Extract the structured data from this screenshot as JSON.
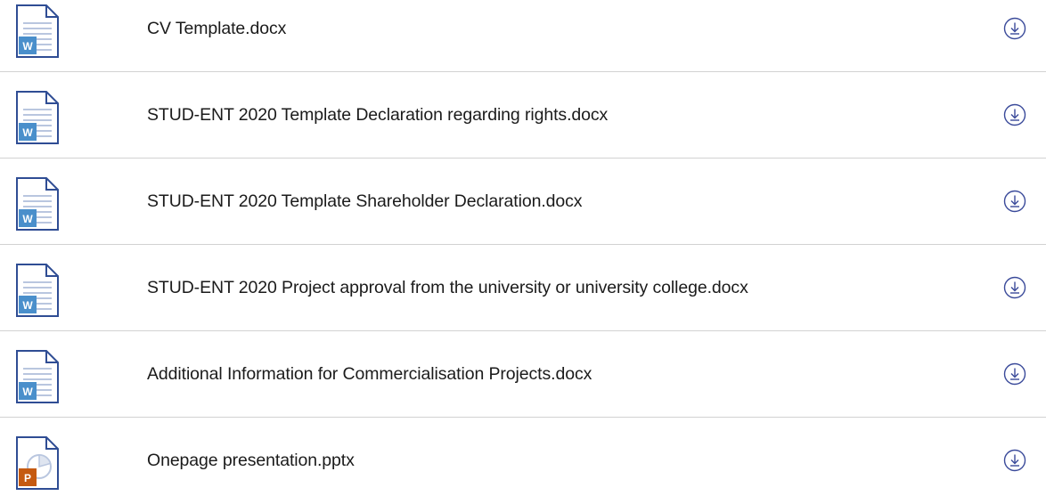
{
  "files": [
    {
      "name": "CV Template.docx",
      "type": "word",
      "badge": "W",
      "icon": "word-document-icon"
    },
    {
      "name": "STUD-ENT 2020 Template Declaration regarding rights.docx",
      "type": "word",
      "badge": "W",
      "icon": "word-document-icon"
    },
    {
      "name": "STUD-ENT 2020 Template Shareholder Declaration.docx",
      "type": "word",
      "badge": "W",
      "icon": "word-document-icon"
    },
    {
      "name": "STUD-ENT 2020 Project approval from the university or university college.docx",
      "type": "word",
      "badge": "W",
      "icon": "word-document-icon"
    },
    {
      "name": "Additional Information for Commercialisation Projects.docx",
      "type": "word",
      "badge": "W",
      "icon": "word-document-icon"
    },
    {
      "name": "Onepage presentation.pptx",
      "type": "powerpoint",
      "badge": "P",
      "icon": "powerpoint-document-icon"
    }
  ],
  "download_icon": "download-icon",
  "colors": {
    "doc_outline": "#2f4d94",
    "word_badge": "#4a8fcb",
    "powerpoint_badge": "#c55a11",
    "download_icon": "#3a4a9a",
    "divider": "#d2d2d2"
  }
}
